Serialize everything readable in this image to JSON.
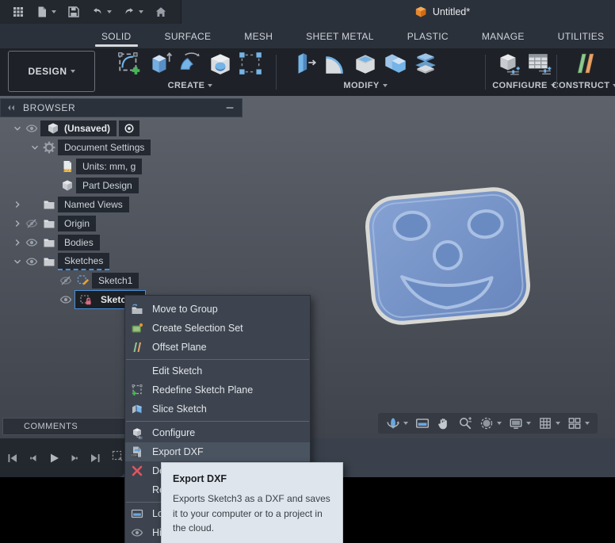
{
  "window": {
    "document_title": "Untitled*"
  },
  "qat": {
    "items": [
      {
        "icon": "app-grid-icon",
        "caret": false
      },
      {
        "icon": "file-new-icon",
        "caret": true
      },
      {
        "icon": "save-icon",
        "caret": false
      },
      {
        "icon": "undo-icon",
        "caret": true
      },
      {
        "icon": "redo-icon",
        "caret": true
      },
      {
        "icon": "home-icon",
        "caret": false
      }
    ]
  },
  "ribbon_tabs": {
    "active": "SOLID",
    "tabs": [
      "SOLID",
      "SURFACE",
      "MESH",
      "SHEET METAL",
      "PLASTIC",
      "MANAGE",
      "UTILITIES"
    ]
  },
  "workspace": {
    "label": "DESIGN"
  },
  "ribbon_groups": [
    {
      "label": "CREATE",
      "tools": [
        "create-sketch-icon",
        "extrude-icon",
        "revolve-icon",
        "hole-icon",
        "pattern-icon"
      ]
    },
    {
      "label": "MODIFY",
      "tools": [
        "press-pull-icon",
        "fillet-icon",
        "shell-icon",
        "combine-icon",
        "split-body-icon"
      ]
    },
    {
      "label": "CONFIGURE",
      "tools": [
        "configure-icon",
        "configuration-table-icon"
      ]
    },
    {
      "label": "CONSTRUCT",
      "tools": [
        "construct-plane-icon"
      ]
    }
  ],
  "browser": {
    "title": "BROWSER",
    "rows": [
      {
        "offset": 14,
        "chevron": "down",
        "eye": "on",
        "boxIcon": "cube-icon",
        "label": "(Unsaved)",
        "bold": true,
        "radio": true
      },
      {
        "offset": 36,
        "chevron": "down",
        "icon": "gear-icon",
        "label": "Document Settings"
      },
      {
        "offset": 74,
        "icon": "units-icon",
        "label": "Units: mm, g"
      },
      {
        "offset": 74,
        "icon": "cube-icon",
        "label": "Part Design"
      },
      {
        "offset": 14,
        "chevron": "right",
        "eye": "none",
        "icon": "folder-icon",
        "label": "Named Views"
      },
      {
        "offset": 14,
        "chevron": "right",
        "eye": "off",
        "icon": "folder-icon",
        "label": "Origin"
      },
      {
        "offset": 14,
        "chevron": "right",
        "eye": "on",
        "icon": "folder-icon",
        "label": "Bodies"
      },
      {
        "offset": 14,
        "chevron": "down",
        "eye": "on",
        "icon": "folder-icon",
        "label": "Sketches",
        "drop": true
      },
      {
        "offset": 72,
        "eye": "off",
        "icon": "sketch-edit-icon",
        "label": "Sketch1"
      },
      {
        "offset": 72,
        "eye": "on",
        "icon": "sketch-lock-icon",
        "label": "Sketch3",
        "selected": true
      }
    ]
  },
  "context_menu": {
    "items": [
      {
        "icon": "move-to-group-icon",
        "label": "Move to Group"
      },
      {
        "icon": "create-selection-set-icon",
        "label": "Create Selection Set"
      },
      {
        "icon": "offset-plane-icon",
        "label": "Offset Plane"
      },
      {
        "type": "separator"
      },
      {
        "icon": "edit-sketch-icon",
        "label": "Edit Sketch"
      },
      {
        "icon": "redefine-sketch-plane-icon",
        "label": "Redefine Sketch Plane"
      },
      {
        "icon": "slice-sketch-icon",
        "label": "Slice Sketch"
      },
      {
        "type": "separator"
      },
      {
        "icon": "configure-menu-icon",
        "label": "Configure"
      },
      {
        "icon": "export-dxf-icon",
        "label": "Export DXF",
        "highlighted": true
      },
      {
        "icon": "delete-icon",
        "label": "Delete"
      },
      {
        "icon": "none",
        "label": "Rename"
      },
      {
        "type": "separator"
      },
      {
        "icon": "look-at-icon",
        "label": "Look At"
      },
      {
        "icon": "hide-icon",
        "label": "Hide"
      }
    ]
  },
  "tooltip": {
    "title": "Export DXF",
    "body": "Exports Sketch3 as a DXF and saves it to your computer or to a project in the cloud."
  },
  "comments": {
    "label": "COMMENTS"
  },
  "playback": {
    "items": [
      "skip-start-icon",
      "step-back-icon",
      "play-icon",
      "step-forward-icon",
      "skip-end-icon"
    ]
  },
  "nav_bar": {
    "items": [
      {
        "icon": "orbit-icon",
        "caret": true
      },
      {
        "icon": "look-at-icon",
        "caret": false
      },
      {
        "icon": "pan-icon",
        "caret": false
      },
      {
        "icon": "zoom-icon",
        "caret": false
      },
      {
        "icon": "fit-icon",
        "caret": true
      },
      {
        "icon": "display-settings-icon",
        "caret": true
      },
      {
        "icon": "grid-display-icon",
        "caret": true
      },
      {
        "icon": "viewports-icon",
        "caret": true
      }
    ]
  },
  "colors": {
    "accent_blue": "#74b4e8",
    "selection_blue": "#4a90d9",
    "doc_cube_orange": "#e8872e",
    "delete_red": "#e05560",
    "tooltip_bg": "#dfe5ec",
    "model_face_blue": "#7494ca"
  }
}
